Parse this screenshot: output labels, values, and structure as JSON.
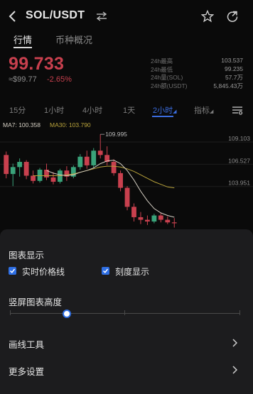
{
  "header": {
    "pair": "SOL/USDT"
  },
  "top_tabs": [
    {
      "label": "行情",
      "active": true
    },
    {
      "label": "币种概况",
      "active": false
    }
  ],
  "price": {
    "last": "99.733",
    "fiat": "≈$99.77",
    "change": "-2.65%"
  },
  "stats": [
    {
      "label": "24h最高",
      "value": "103.537"
    },
    {
      "label": "24h最低",
      "value": "99.235"
    },
    {
      "label": "24h量(SOL)",
      "value": "57.7万"
    },
    {
      "label": "24h额(USDT)",
      "value": "5,845.43万"
    }
  ],
  "intervals": [
    {
      "label": "15分",
      "active": false
    },
    {
      "label": "1小时",
      "active": false
    },
    {
      "label": "4小时",
      "active": false
    },
    {
      "label": "1天",
      "active": false
    },
    {
      "label": "2小时",
      "active": true
    },
    {
      "label": "指标",
      "active": false
    }
  ],
  "ma": {
    "ma7": "MA7: 100.358",
    "ma30": "MA30: 103.790"
  },
  "chart_data": {
    "type": "candlestick",
    "price_labels": [
      "109.103",
      "106.527",
      "103.951"
    ],
    "high_annotation": "109.995",
    "ylim": [
      99.0,
      110.5
    ],
    "candles": [
      {
        "o": 107.6,
        "h": 108.0,
        "l": 104.9,
        "c": 105.4
      },
      {
        "o": 105.4,
        "h": 106.6,
        "l": 104.0,
        "c": 106.2
      },
      {
        "o": 106.2,
        "h": 107.2,
        "l": 105.1,
        "c": 106.8
      },
      {
        "o": 106.8,
        "h": 107.0,
        "l": 104.8,
        "c": 105.2
      },
      {
        "o": 105.2,
        "h": 105.8,
        "l": 104.3,
        "c": 104.6
      },
      {
        "o": 104.6,
        "h": 106.1,
        "l": 104.4,
        "c": 105.9
      },
      {
        "o": 105.9,
        "h": 106.6,
        "l": 104.7,
        "c": 105.0
      },
      {
        "o": 105.0,
        "h": 105.6,
        "l": 104.2,
        "c": 104.5
      },
      {
        "o": 104.5,
        "h": 106.0,
        "l": 104.3,
        "c": 105.8
      },
      {
        "o": 105.8,
        "h": 106.3,
        "l": 104.6,
        "c": 105.1
      },
      {
        "o": 105.1,
        "h": 106.4,
        "l": 104.9,
        "c": 106.2
      },
      {
        "o": 106.2,
        "h": 107.7,
        "l": 105.9,
        "c": 107.4
      },
      {
        "o": 107.4,
        "h": 108.1,
        "l": 106.0,
        "c": 106.4
      },
      {
        "o": 106.4,
        "h": 108.4,
        "l": 106.1,
        "c": 108.1
      },
      {
        "o": 108.1,
        "h": 109.995,
        "l": 107.2,
        "c": 107.6
      },
      {
        "o": 107.6,
        "h": 108.6,
        "l": 106.4,
        "c": 106.8
      },
      {
        "o": 106.8,
        "h": 107.1,
        "l": 105.2,
        "c": 105.5
      },
      {
        "o": 105.5,
        "h": 105.8,
        "l": 103.4,
        "c": 103.8
      },
      {
        "o": 103.8,
        "h": 104.0,
        "l": 101.2,
        "c": 101.6
      },
      {
        "o": 101.6,
        "h": 102.0,
        "l": 99.9,
        "c": 100.4
      },
      {
        "o": 100.4,
        "h": 101.0,
        "l": 99.6,
        "c": 100.1
      },
      {
        "o": 100.1,
        "h": 100.6,
        "l": 99.5,
        "c": 99.9
      },
      {
        "o": 99.9,
        "h": 100.8,
        "l": 99.7,
        "c": 100.6
      },
      {
        "o": 100.6,
        "h": 100.9,
        "l": 99.8,
        "c": 100.1
      },
      {
        "o": 100.1,
        "h": 100.5,
        "l": 99.6,
        "c": 99.8
      },
      {
        "o": 99.8,
        "h": 100.3,
        "l": 99.2,
        "c": 99.7
      }
    ],
    "ma7": [
      null,
      null,
      null,
      null,
      null,
      null,
      105.8,
      105.5,
      105.3,
      105.2,
      105.3,
      105.6,
      105.8,
      106.1,
      106.6,
      106.9,
      107.0,
      106.6,
      105.8,
      104.7,
      103.4,
      102.3,
      101.4,
      100.9,
      100.6,
      100.4
    ],
    "ma30": [
      null,
      null,
      null,
      null,
      105.2,
      105.2,
      105.2,
      105.2,
      105.2,
      105.3,
      105.4,
      105.6,
      105.8,
      106.0,
      106.2,
      106.3,
      106.3,
      106.2,
      106.0,
      105.7,
      105.3,
      104.9,
      104.5,
      104.2,
      103.9,
      103.8
    ]
  },
  "settings_sheet": {
    "chart_display_title": "图表显示",
    "options": [
      {
        "label": "实时价格线",
        "checked": true
      },
      {
        "label": "刻度显示",
        "checked": true
      }
    ],
    "chart_height_title": "竖屏图表高度",
    "chart_height_value": 0.25,
    "drawing_tools_label": "画线工具",
    "more_settings_label": "更多设置"
  },
  "colors": {
    "accent_blue": "#2f6fe4",
    "down_red": "#c8404e",
    "up_green": "#3aa37a",
    "ma7_color": "#d6d0c4",
    "ma30_color": "#b9a33b"
  }
}
